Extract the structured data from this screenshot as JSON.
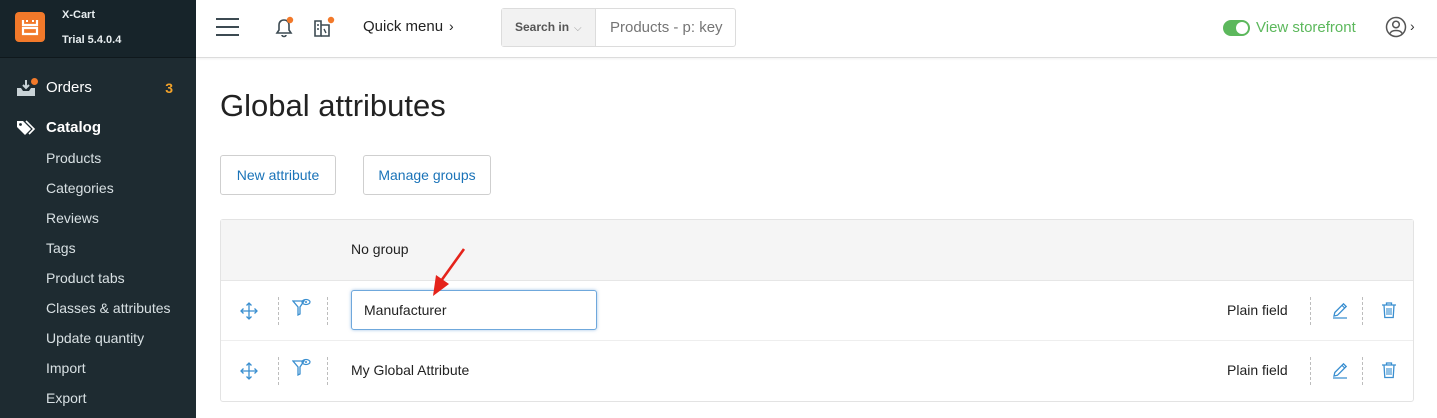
{
  "brand": {
    "name": "X-Cart",
    "version": "Trial 5.4.0.4"
  },
  "sidebar": {
    "orders": {
      "label": "Orders",
      "count": "3"
    },
    "catalog": {
      "label": "Catalog",
      "items": [
        "Products",
        "Categories",
        "Reviews",
        "Tags",
        "Product tabs",
        "Classes & attributes",
        "Update quantity",
        "Import",
        "Export"
      ]
    }
  },
  "topbar": {
    "quick_menu": "Quick menu",
    "search_scope": "Search in",
    "search_placeholder": "Products - p: key",
    "storefront": "View storefront"
  },
  "page": {
    "title": "Global attributes",
    "new_attribute": "New attribute",
    "manage_groups": "Manage groups"
  },
  "table": {
    "group": "No group",
    "rows": [
      {
        "name": "Manufacturer",
        "type": "Plain field",
        "editing": true
      },
      {
        "name": "My Global Attribute",
        "type": "Plain field",
        "editing": false
      }
    ]
  },
  "colors": {
    "sidebar_bg": "#1e2b31",
    "brand_accent": "#f2792a",
    "link_blue": "#1a73b8",
    "storefront_green": "#5cb85c",
    "annotation_red": "#e5231b"
  }
}
